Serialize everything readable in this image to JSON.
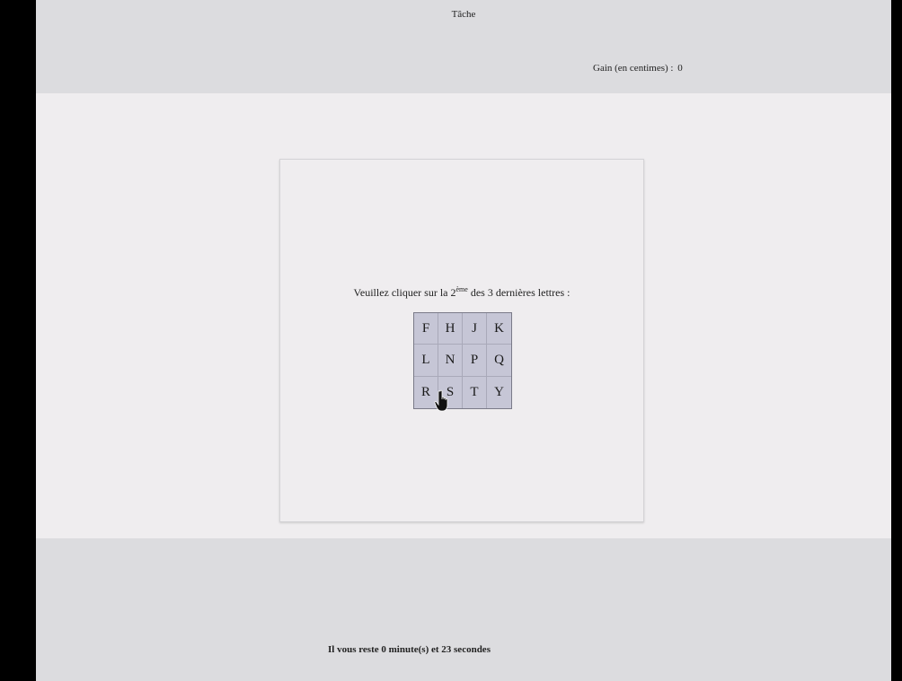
{
  "header": {
    "title": "Tâche",
    "gain_label": "Gain (en centimes) :",
    "gain_value": "0"
  },
  "task": {
    "instruction_before": "Veuillez cliquer sur la 2",
    "instruction_sup": "ème",
    "instruction_after": " des 3 dernières lettres :",
    "letters": [
      "F",
      "H",
      "J",
      "K",
      "L",
      "N",
      "P",
      "Q",
      "R",
      "S",
      "T",
      "Y"
    ]
  },
  "footer": {
    "timer_text": "Il vous reste 0 minute(s) et 23 secondes"
  },
  "cursor": {
    "icon": "hand-pointer-icon"
  }
}
